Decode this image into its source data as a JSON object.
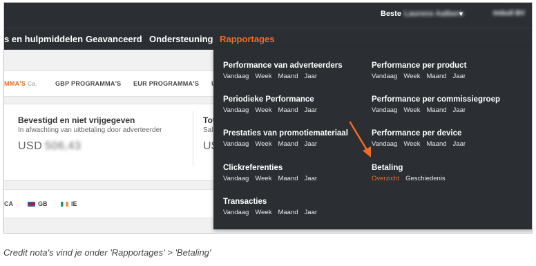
{
  "header": {
    "greeting": "Beste",
    "user_name": "Laurens Aalbers",
    "company": "Imbull BV"
  },
  "nav": {
    "items": [
      {
        "label": "s en hulpmiddelen"
      },
      {
        "label": "Geavanceerd"
      },
      {
        "label": "Ondersteuning"
      },
      {
        "label": "Rapportages"
      }
    ]
  },
  "tabs": [
    {
      "label": "MMA'S",
      "extra": "Ca."
    },
    {
      "label": "GBP PROGRAMMA'S"
    },
    {
      "label": "EUR PROGRAMMA'S"
    },
    {
      "label": "U"
    }
  ],
  "balance": {
    "title": "Bevestigd en niet vrijgegeven",
    "subtitle": "In afwachting van uitbetaling door adverteerder",
    "currency": "USD",
    "amount": "506,43",
    "title2": "Tot",
    "subtitle2": "Sald",
    "currency2": "US"
  },
  "countries": [
    {
      "code": "CA"
    },
    {
      "code": "GB"
    },
    {
      "code": "IE"
    }
  ],
  "menu": {
    "left": [
      {
        "title": "Performance van adverteerders",
        "links": [
          "Vandaag",
          "Week",
          "Maand",
          "Jaar"
        ]
      },
      {
        "title": "Periodieke Performance",
        "links": [
          "Vandaag",
          "Week",
          "Maand",
          "Jaar"
        ]
      },
      {
        "title": "Prestaties van promotiemateriaal",
        "links": [
          "Vandaag",
          "Week",
          "Maand",
          "Jaar"
        ]
      },
      {
        "title": "Clickreferenties",
        "links": [
          "Vandaag",
          "Week",
          "Maand",
          "Jaar"
        ]
      },
      {
        "title": "Transacties",
        "links": [
          "Vandaag",
          "Week",
          "Maand",
          "Jaar"
        ]
      }
    ],
    "right": [
      {
        "title": "Performance per product",
        "links": [
          "Vandaag",
          "Week",
          "Maand",
          "Jaar"
        ]
      },
      {
        "title": "Performance per commissiegroep",
        "links": [
          "Vandaag",
          "Week",
          "Maand",
          "Jaar"
        ]
      },
      {
        "title": "Performance per device",
        "links": [
          "Vandaag",
          "Week",
          "Maand",
          "Jaar"
        ]
      },
      {
        "title": "Betaling",
        "links": [
          "Overzicht",
          "Geschiedenis"
        ]
      }
    ]
  },
  "caption": "Credit nota's vind je onder 'Rapportages' > 'Betaling'",
  "colors": {
    "accent": "#f26b21",
    "nav_bg": "#2b2f33",
    "arrow": "#f26b21"
  }
}
